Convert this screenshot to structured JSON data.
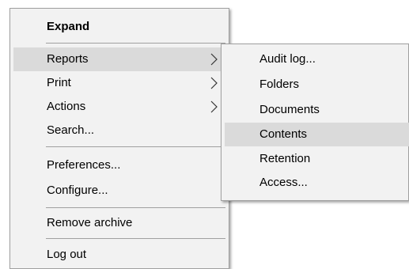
{
  "main_menu": {
    "expand": "Expand",
    "reports": "Reports",
    "print": "Print",
    "actions": "Actions",
    "search": "Search...",
    "preferences": "Preferences...",
    "configure": "Configure...",
    "remove_archive": "Remove archive",
    "log_out": "Log out"
  },
  "sub_menu": {
    "items": [
      "Audit log...",
      "Folders",
      "Documents",
      "Contents",
      "Retention",
      "Access..."
    ],
    "highlighted_index": 3
  },
  "colors": {
    "menu_background": "#f2f2f2",
    "highlight": "#dadada",
    "separator": "#a0a0a0",
    "text": "#000000"
  },
  "icons": {
    "submenu_arrow": "chevron-right-icon"
  }
}
